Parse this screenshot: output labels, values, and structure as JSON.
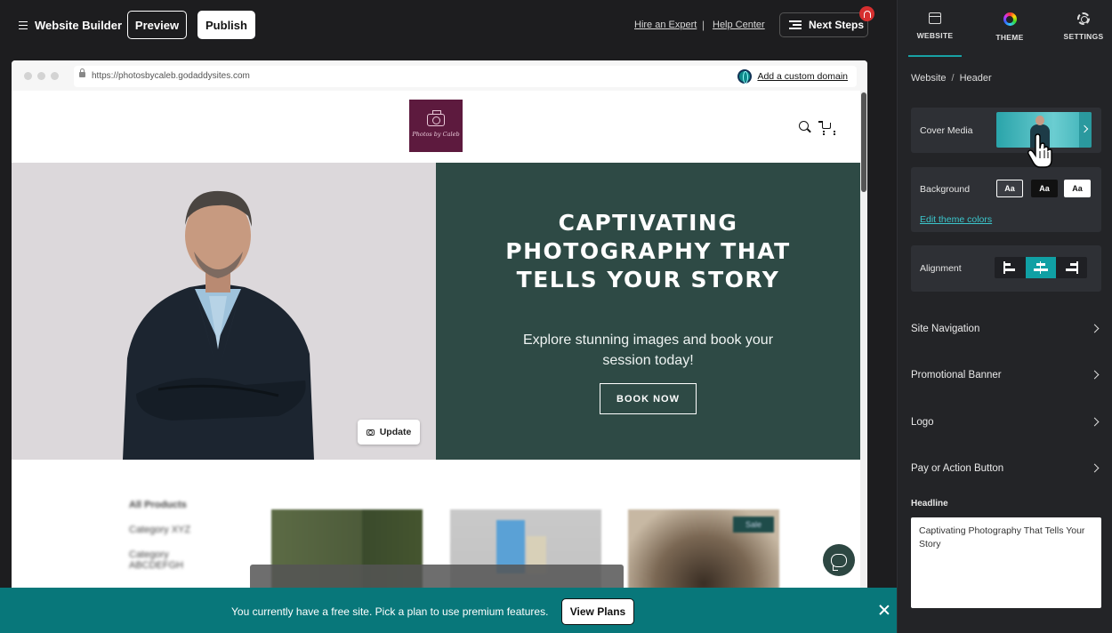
{
  "topbar": {
    "app_title": "Website Builder",
    "preview_label": "Preview",
    "publish_label": "Publish",
    "hire_expert": "Hire an Expert",
    "separator": "|",
    "help_center": "Help Center",
    "next_steps": "Next Steps"
  },
  "browser": {
    "url": "https://photosbycaleb.godaddysites.com",
    "custom_domain": "Add a custom domain"
  },
  "site": {
    "logo_text": "Photos by Caleb",
    "hero_title": "CAPTIVATING PHOTOGRAPHY THAT TELLS YOUR STORY",
    "hero_subtitle": "Explore stunning images and book your session today!",
    "cta_label": "BOOK NOW",
    "update_label": "Update",
    "categories": [
      "All Products",
      "Category XYZ",
      "Category ABCDEFGH"
    ],
    "sale_badge": "Sale"
  },
  "banner": {
    "text": "You currently have a free site. Pick a plan to use premium features.",
    "view_plans": "View Plans"
  },
  "panel": {
    "tabs": [
      {
        "label": "WEBSITE",
        "icon": "website-icon",
        "active": true
      },
      {
        "label": "THEME",
        "icon": "theme-icon",
        "active": false
      },
      {
        "label": "SETTINGS",
        "icon": "gear-icon",
        "active": false
      }
    ],
    "breadcrumb": {
      "root": "Website",
      "current": "Header"
    },
    "cover_media": "Cover Media",
    "background": {
      "label": "Background",
      "options": [
        "Aa",
        "Aa",
        "Aa"
      ],
      "edit_link": "Edit theme colors"
    },
    "alignment": {
      "label": "Alignment",
      "selected": "center"
    },
    "sections": [
      "Site Navigation",
      "Promotional Banner",
      "Logo",
      "Pay or Action Button"
    ],
    "headline_label": "Headline",
    "headline_value": "Captivating Photography That Tells Your Story"
  },
  "colors": {
    "accent": "#10a0a4",
    "hero_right": "#2e4a45",
    "banner": "#08777a",
    "logo_bg": "#5d1a3e"
  }
}
